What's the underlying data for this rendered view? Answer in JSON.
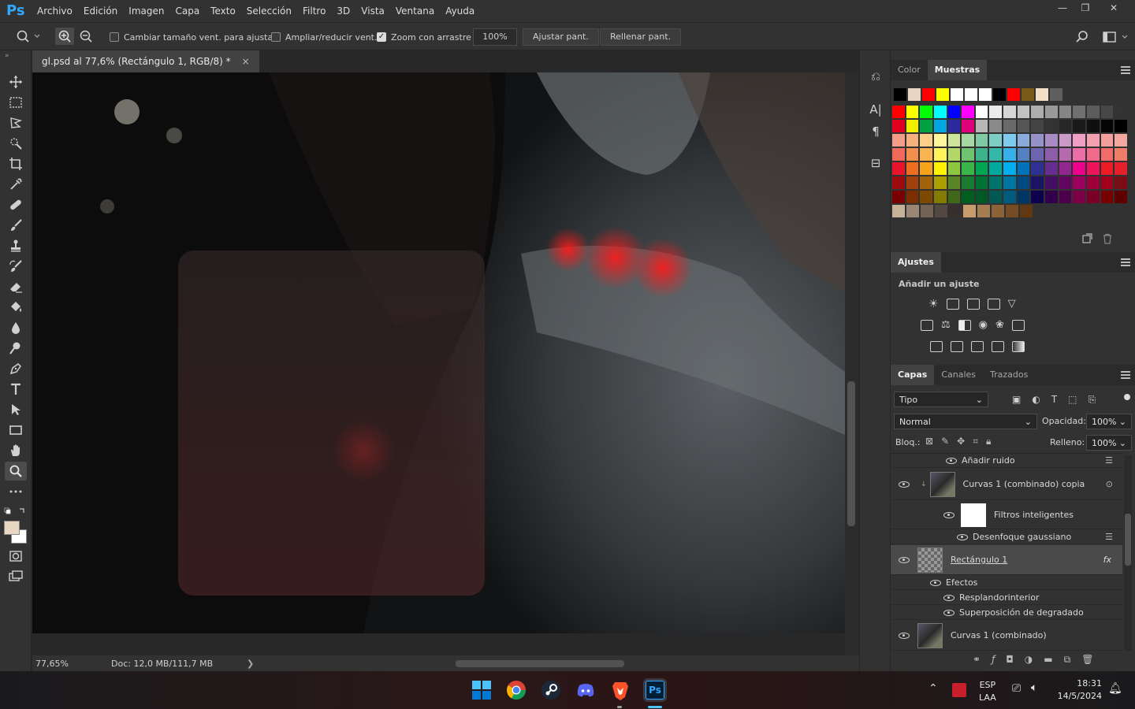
{
  "app": {
    "logo": "Ps"
  },
  "menu": [
    "Archivo",
    "Edición",
    "Imagen",
    "Capa",
    "Texto",
    "Selección",
    "Filtro",
    "3D",
    "Vista",
    "Ventana",
    "Ayuda"
  ],
  "window_controls": {
    "minimize": "—",
    "restore": "❐",
    "close": "✕"
  },
  "options": {
    "resize_window": "Cambiar tamaño vent. para ajustar",
    "zoom_all": "Ampliar/reducir vent.",
    "scrubby_zoom": "Zoom con arrastre",
    "zoom_value": "100%",
    "fit_screen": "Ajustar pant.",
    "fill_screen": "Rellenar pant."
  },
  "document": {
    "tab_title": "gl.psd al 77,6% (Rectángulo 1, RGB/8) *",
    "tab_close": "×"
  },
  "status": {
    "zoom": "77,65%",
    "doc_size": "Doc: 12,0 MB/111,7 MB",
    "arrow": "❯"
  },
  "panels": {
    "color_tab": "Color",
    "swatches_tab": "Muestras",
    "adjust_tab": "Ajustes",
    "add_adjustment": "Añadir un ajuste",
    "layers_tab": "Capas",
    "channels_tab": "Canales",
    "paths_tab": "Trazados"
  },
  "swatches": {
    "recent": [
      "#000000",
      "#e8d7c2",
      "#ff0000",
      "#ffff00",
      "#ffffff",
      "#ffffff",
      "#ffffff",
      "#000000",
      "#ff0000",
      "#7a5c18",
      "#f1dfc6",
      "#5e5e5e"
    ],
    "rows": [
      [
        "#ff0000",
        "#ffff00",
        "#00ff00",
        "#00ffff",
        "#0000ff",
        "#ff00ff",
        "#ffffff",
        "#ebebeb",
        "#d6d6d6",
        "#c2c2c2",
        "#adadad",
        "#999999",
        "#858585",
        "#707070",
        "#5c5c5c",
        "#474747",
        "#333333"
      ],
      [
        "#e00020",
        "#f2ee00",
        "#00a140",
        "#00a6e0",
        "#2a2a9e",
        "#e0007a",
        "#b8b8b8",
        "#8a8a8a",
        "#6a6a6a",
        "#555555",
        "#444444",
        "#333333",
        "#262626",
        "#1a1a1a",
        "#0f0f0f",
        "#050505",
        "#000000"
      ],
      [
        "#f29c8a",
        "#f5b07e",
        "#fbce8a",
        "#fff59d",
        "#cde59a",
        "#a6d8a3",
        "#7fcaa4",
        "#7dcdc4",
        "#7fcbf0",
        "#8aaad9",
        "#9592c8",
        "#a98bc3",
        "#c99ac6",
        "#ef9fc5",
        "#f29fb0",
        "#f59e9e",
        "#f4a7a0"
      ],
      [
        "#ef6a5a",
        "#f38f4d",
        "#f9b451",
        "#fff25a",
        "#b3d86a",
        "#6fc371",
        "#3db38c",
        "#34b6a9",
        "#37afe8",
        "#5580c2",
        "#6c66b0",
        "#8d5ea8",
        "#b46aad",
        "#ec6ea6",
        "#ef6a8b",
        "#f16b6b",
        "#ee7d6a"
      ],
      [
        "#e8142b",
        "#ee6d1f",
        "#f7a21b",
        "#fff200",
        "#8dc63f",
        "#39b54a",
        "#00a651",
        "#00a99d",
        "#00aeef",
        "#0072bc",
        "#2e3192",
        "#662d91",
        "#92278f",
        "#ec008c",
        "#ed145b",
        "#ed1c24",
        "#e51f2b"
      ],
      [
        "#9e0b0f",
        "#a0410d",
        "#a36209",
        "#aba000",
        "#598527",
        "#197b30",
        "#007236",
        "#00746b",
        "#0076a3",
        "#004a80",
        "#1b1464",
        "#440e62",
        "#630460",
        "#9e005d",
        "#9e0039",
        "#a1001f",
        "#7a0c14"
      ],
      [
        "#790000",
        "#7b2e00",
        "#7d4900",
        "#827b00",
        "#406618",
        "#005e20",
        "#005826",
        "#005952",
        "#005b7f",
        "#003663",
        "#0d004c",
        "#32004b",
        "#4b0049",
        "#7b0046",
        "#7a0026",
        "#790000",
        "#5e0000"
      ],
      [
        "#c7b299",
        "#998675",
        "#736357",
        "#534741",
        "#362f2d",
        "#c69c6d",
        "#a67c52",
        "#8c6239",
        "#754c24",
        "#603913"
      ]
    ]
  },
  "layers": {
    "filter_kind": "Tipo",
    "blend_mode": "Normal",
    "opacity_label": "Opacidad:",
    "opacity_value": "100%",
    "lock_label": "Bloq.:",
    "fill_label": "Relleno:",
    "fill_value": "100%",
    "rows": {
      "add_noise": "Añadir ruido",
      "curves_copy": "Curvas 1 (combinado) copia",
      "smart_filters": "Filtros inteligentes",
      "gaussian_blur": "Desenfoque gaussiano",
      "rectangle": "Rectángulo 1",
      "fx": "fx",
      "effects": "Efectos",
      "inner_glow": "Resplandorinterior",
      "gradient_overlay": "Superposición de degradado",
      "curves": "Curvas 1 (combinado)"
    }
  },
  "taskbar": {
    "lang_top": "ESP",
    "lang_bottom": "LAA",
    "time": "18:31",
    "date": "14/5/2024",
    "ps_label": "Ps"
  }
}
